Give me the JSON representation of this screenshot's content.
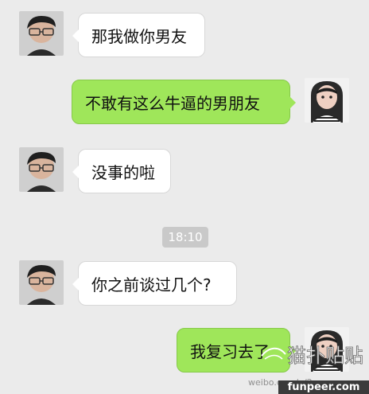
{
  "conversation": {
    "messages": [
      {
        "side": "left",
        "text": "那我做你男友"
      },
      {
        "side": "right",
        "text": "不敢有这么牛逼的男朋友"
      },
      {
        "side": "left",
        "text": "没事的啦"
      },
      {
        "side": "left",
        "text": "你之前谈过几个?"
      },
      {
        "side": "right",
        "text": "我复习去了"
      }
    ],
    "timestamp": "18:10"
  },
  "watermark": {
    "title": "猫扑贴贴",
    "subtitle": "weibo.com/u/2",
    "site": "funpeer.com"
  },
  "colors": {
    "background": "#ebebeb",
    "left_bubble": "#ffffff",
    "right_bubble": "#9fe65a",
    "time_badge": "#c9c9c9"
  }
}
